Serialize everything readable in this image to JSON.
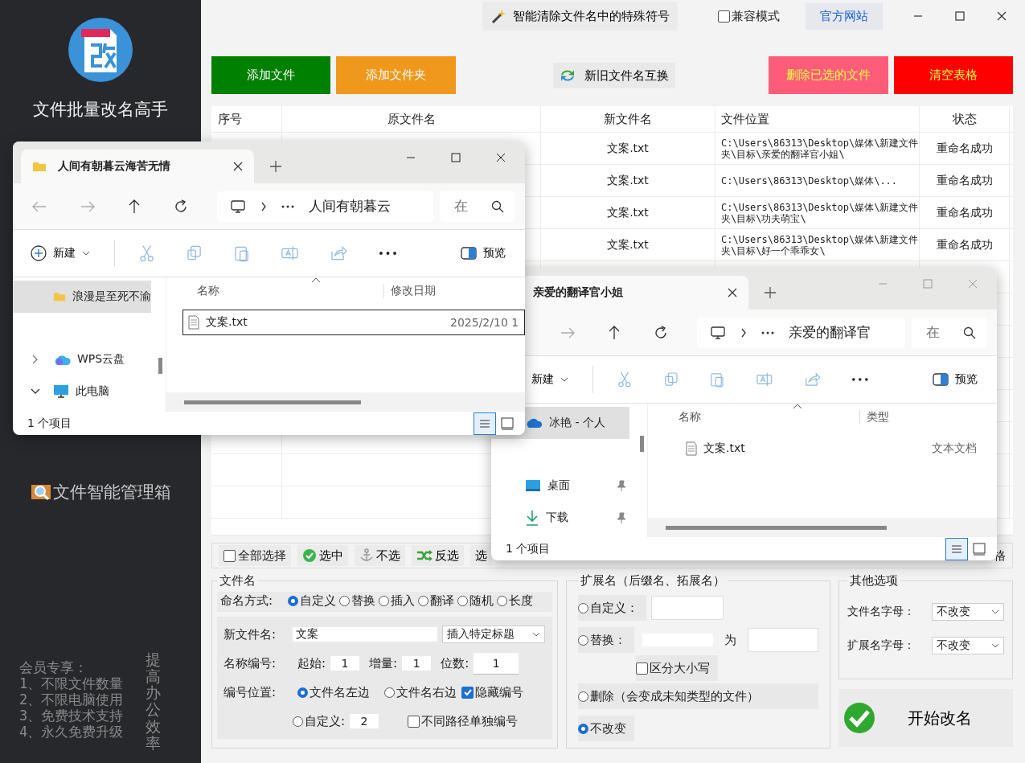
{
  "sidebar": {
    "app_title": "文件批量改名高手",
    "items": [
      {
        "label": "文件智能管理箱"
      }
    ],
    "member_note": {
      "heading": "会员专享：",
      "lines": [
        "1、不限文件数量",
        "2、不限电脑使用",
        "3、免费技术支持",
        "4、永久免费升级"
      ]
    },
    "slogan": "提高办公效率"
  },
  "top_bar": {
    "clean_button": "智能清除文件名中的特殊符号",
    "compat_mode": {
      "label": "兼容模式",
      "checked": false
    },
    "website_link": "官方网站"
  },
  "actions": [
    {
      "label": "添加文件",
      "kind": "add",
      "color": "#008000"
    },
    {
      "label": "添加文件夹",
      "kind": "add",
      "color": "#f0981c"
    },
    {
      "label": "新旧文件名互换",
      "kind": "swap"
    },
    {
      "label": "删除已选的文件",
      "kind": "remove",
      "color": "#ff5c7a"
    },
    {
      "label": "清空表格",
      "kind": "remove",
      "color": "#ff0000"
    }
  ],
  "table": {
    "columns": [
      "序号",
      "原文件名",
      "新文件名",
      "文件位置",
      "状态"
    ],
    "rows": [
      {
        "new_name": "文案.txt",
        "location": "C:\\Users\\86313\\Desktop\\媒体\\新建文件夹\\目标\\亲爱的翻译官小姐\\",
        "status": "重命名成功"
      },
      {
        "new_name": "文案.txt",
        "location": "C:\\Users\\86313\\Desktop\\媒体\\...",
        "status": "重命名成功"
      },
      {
        "new_name": "文案.txt",
        "location": "C:\\Users\\86313\\Desktop\\媒体\\新建文件夹\\目标\\功夫萌宝\\",
        "status": "重命名成功"
      },
      {
        "new_name": "文案.txt",
        "location": "C:\\Users\\86313\\Desktop\\媒体\\新建文件夹\\目标\\好一个乖乖女\\",
        "status": "重命名成功"
      }
    ]
  },
  "selection_bar": {
    "select_all": {
      "label": "全部选择",
      "checked": false
    },
    "buttons": [
      {
        "label": "选中",
        "kind": "check"
      },
      {
        "label": "不选",
        "kind": "anchor"
      },
      {
        "label": "反选",
        "kind": "shuffle"
      },
      {
        "label": "选",
        "kind": "plain"
      }
    ],
    "trailing": "格"
  },
  "filename_panel": {
    "title": "文件名",
    "mode_label": "命名方式:",
    "modes": [
      {
        "label": "自定义",
        "selected": true
      },
      {
        "label": "替换",
        "selected": false
      },
      {
        "label": "插入",
        "selected": false
      },
      {
        "label": "翻译",
        "selected": false
      },
      {
        "label": "随机",
        "selected": false
      },
      {
        "label": "长度",
        "selected": false
      }
    ],
    "new_name": {
      "label": "新文件名:",
      "value": "文案",
      "dropdown": "插入特定标题"
    },
    "numbering": {
      "label": "名称编号:",
      "fields": [
        {
          "label": "起始:",
          "value": "1"
        },
        {
          "label": "增量:",
          "value": "1"
        },
        {
          "label": "位数:",
          "value": "1"
        }
      ]
    },
    "position": {
      "label": "编号位置:",
      "options": [
        {
          "label": "文件名左边",
          "selected": true
        },
        {
          "label": "文件名右边",
          "selected": false
        },
        {
          "label": "自定义:",
          "selected": false
        }
      ],
      "custom_value": "2",
      "hide_number": {
        "label": "隐藏编号",
        "checked": true
      },
      "separate": {
        "label": "不同路径单独编号",
        "checked": false
      }
    }
  },
  "extension_panel": {
    "title": "扩展名（后缀名、拓展名）",
    "custom": {
      "label": "自定义：",
      "selected": false
    },
    "replace": {
      "label": "替换：",
      "joiner": "为",
      "selected": false
    },
    "case_sensitive": {
      "label": "区分大小写",
      "checked": false
    },
    "delete": {
      "label": "删除（会变成未知类型的文件）",
      "selected": false
    },
    "keep": {
      "label": "不改变",
      "selected": true
    }
  },
  "other_options": {
    "title": "其他选项",
    "fields": [
      {
        "label": "文件名字母：",
        "value": "不改变"
      },
      {
        "label": "扩展名字母：",
        "value": "不改变"
      }
    ]
  },
  "start_button": "开始改名",
  "explorer_front": {
    "tab_title": "人间有朝暮云海苦无情",
    "address": "人间有朝暮云",
    "search_placeholder": "在",
    "new_label": "新建",
    "preview_label": "预览",
    "nav_items": [
      {
        "label": "浪漫是至死不渝",
        "kind": "folder",
        "selected": true
      },
      {
        "label": "WPS云盘",
        "kind": "cloud",
        "selected": false,
        "expanded": false
      },
      {
        "label": "此电脑",
        "kind": "pc",
        "selected": false,
        "expanded": true
      }
    ],
    "columns": [
      "名称",
      "修改日期"
    ],
    "files": [
      {
        "name": "文案.txt",
        "column_2": "2025/2/10 1",
        "selected": true
      }
    ],
    "status": "1 个项目"
  },
  "explorer_back": {
    "tab_title": "亲爱的翻译官小姐",
    "address": "亲爱的翻译官",
    "search_placeholder": "在",
    "new_label": "新建",
    "preview_label": "预览",
    "nav_items": [
      {
        "label": "冰艳 - 个人",
        "kind": "onedrive",
        "selected": true
      },
      {
        "label": "桌面",
        "kind": "desktop",
        "selected": false
      },
      {
        "label": "下载",
        "kind": "download",
        "selected": false
      }
    ],
    "columns": [
      "名称",
      "类型"
    ],
    "files": [
      {
        "name": "文案.txt",
        "column_2": "文本文档",
        "selected": false
      }
    ],
    "status": "1 个项目"
  }
}
